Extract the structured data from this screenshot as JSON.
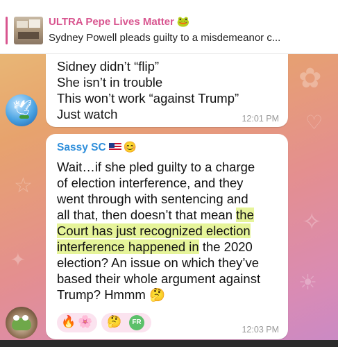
{
  "pinned": {
    "title": "ULTRA Pepe Lives Matter",
    "title_emoji": "🐸",
    "message": "Sydney Powell pleads guilty to a misdemeanor c..."
  },
  "messages": [
    {
      "lines": [
        "Sidney didn’t “flip”",
        "She isn’t in trouble",
        "This won’t work “against Trump”",
        "Just watch"
      ],
      "time": "12:01 PM"
    },
    {
      "sender": "Sassy SC",
      "sender_emoji": "😊",
      "lines": [
        "Wait…if she pled guilty to a charge",
        "of election interference, and they",
        "went through with sentencing and",
        "all that, then doesn’t that mean ",
        "the",
        "Court has just recognized election",
        "interference happened in",
        " the 2020",
        "election? An issue on which they’ve",
        "based their whole argument against",
        "Trump? Hmmm",
        "🤔"
      ],
      "time": "12:03 PM",
      "reactions": [
        {
          "emoji": "🔥",
          "second": "🌸"
        },
        {
          "emoji": "🤔",
          "avatar_initials": "FR"
        }
      ]
    }
  ],
  "colors": {
    "sender": "#2f8fdb",
    "pinned_title": "#d8558f",
    "highlight": "#def078"
  }
}
